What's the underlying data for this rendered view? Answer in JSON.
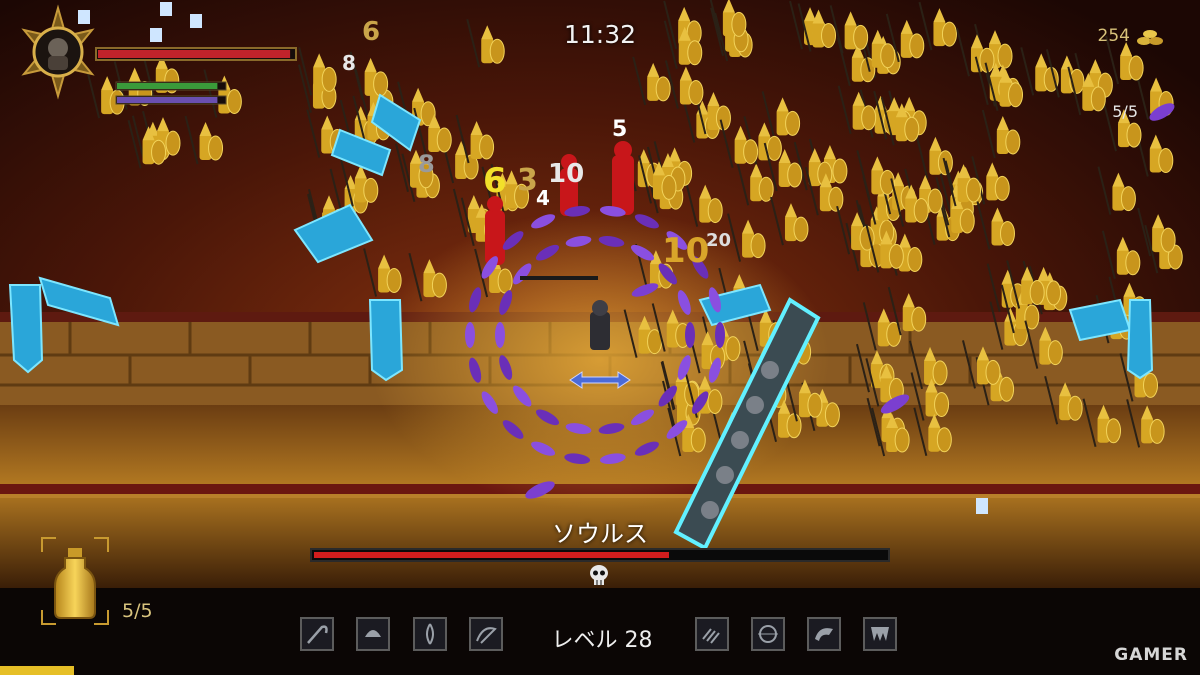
{
  "hud": {
    "timer": "11:32",
    "gold_count": "254",
    "counter_top_right": "5/5",
    "boss_name": "ソウルス",
    "boss_health_fraction": 0.62,
    "level_label": "レベル 28",
    "flask_count": "5/5",
    "watermark": "GAMER",
    "player_health_fraction": 0.98,
    "player_stamina_fraction": 0.93,
    "player_mana_fraction": 0.93
  },
  "damage_numbers": [
    "8",
    "5",
    "6",
    "3",
    "10",
    "4",
    "10",
    "20",
    "6",
    "8"
  ],
  "skill_slots_left": [
    "scythe-icon",
    "helmet-icon",
    "tentacle-icon",
    "whip-icon"
  ],
  "skill_slots_right": [
    "claw-icon",
    "web-icon",
    "horn-icon",
    "fang-icon"
  ],
  "colors": {
    "boss_bar": "#d11d1d",
    "health_bar": "#c1232b",
    "stamina_bar": "#3a9a3a",
    "mana_bar": "#6a4fb0",
    "gold": "#d8c27a",
    "soldier_gold": "#d6a623",
    "floor_glow": "#c9891f"
  }
}
